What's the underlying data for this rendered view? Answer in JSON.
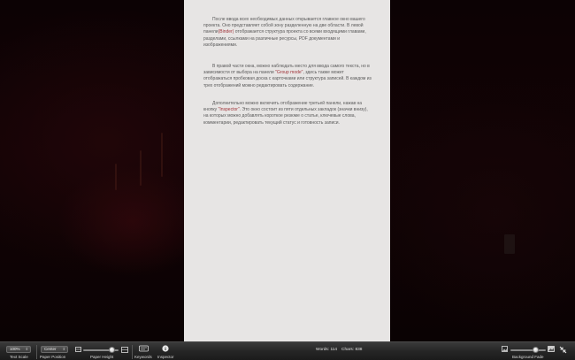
{
  "document": {
    "paragraphs": [
      {
        "before": "После ввода всех необходимых данных открывается главное окно вашего проекта. Оно представляет собой зону разделенную на две области. В левой панели",
        "highlight": "(Binder)",
        "after": " отображается структура проекта со всеми входящими главами, разделами, ссылками на различные ресурсы, PDF документами и изображениями."
      },
      {
        "before": "В правой части окна, можно наблюдать место для ввода самого текста, но в зависимости от выбора на панели ",
        "highlight": "\"Group mode\"",
        "after": ", здесь также может отображаться пробковая доска с карточками или структура записей. В каждом из трех отображений можно редактировать содержание."
      },
      {
        "before": "Дополнительно можно включить отображение третьей панели, нажав на кнопку ",
        "highlight": "\"Inspector\"",
        "after": ". Это окно состоит из пяти отдельных закладок (значки внизу), на которых можно добавлять короткое резюме о статье, ключевые слова, комментарии, редактировать текущий статус и готовность записи."
      }
    ]
  },
  "toolbar": {
    "text_scale_value": "100%",
    "text_scale_label": "Text Scale",
    "paper_position_value": "Center",
    "paper_position_label": "Paper Position",
    "paper_height_label": "Paper Height",
    "paper_height_level": 0.8,
    "keywords_label": "Keywords",
    "inspector_label": "Inspector",
    "words_text": "Words: 114",
    "chars_text": "Chars: 838",
    "background_fade_label": "Background Fade",
    "background_fade_level": 0.72
  },
  "icons": {
    "paper_small": "paper-small-icon",
    "paper_large": "paper-large-icon",
    "keywords": "keywords-icon",
    "inspector": "info-icon",
    "fade_low": "picture-low-icon",
    "fade_high": "picture-high-icon",
    "exit_fullscreen": "exit-fullscreen-icon"
  },
  "colors": {
    "paper": "#e7e5e4",
    "highlight": "#a0343a",
    "toolbar": "#262626",
    "backdrop": "#120305"
  }
}
